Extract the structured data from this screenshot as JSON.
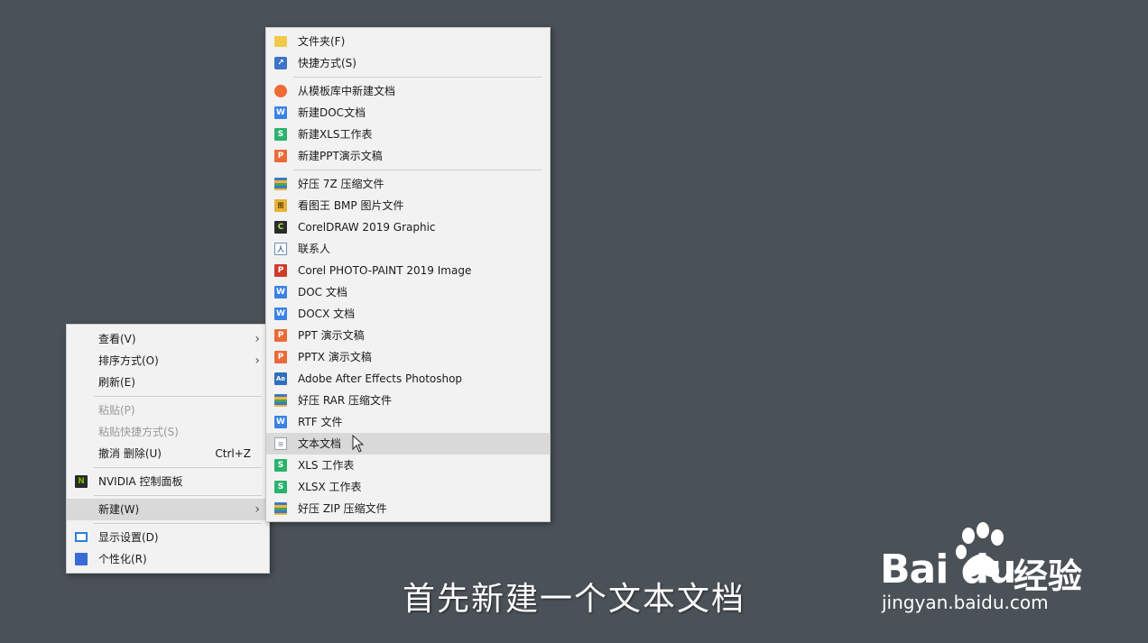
{
  "context_menu": {
    "items": [
      {
        "label": "查看(V)",
        "submenu": true
      },
      {
        "label": "排序方式(O)",
        "submenu": true
      },
      {
        "label": "刷新(E)"
      },
      {
        "label": "粘贴(P)",
        "disabled": true
      },
      {
        "label": "粘贴快捷方式(S)",
        "disabled": true
      },
      {
        "label": "撤消 删除(U)",
        "shortcut": "Ctrl+Z"
      },
      {
        "label": "NVIDIA 控制面板",
        "icon": "nvidia-icon"
      },
      {
        "label": "新建(W)",
        "submenu": true,
        "highlighted": true
      },
      {
        "label": "显示设置(D)",
        "icon": "display-icon"
      },
      {
        "label": "个性化(R)",
        "icon": "personalize-icon"
      }
    ]
  },
  "new_submenu": {
    "items": [
      {
        "label": "文件夹(F)",
        "icon": "folder-icon"
      },
      {
        "label": "快捷方式(S)",
        "icon": "shortcut-icon"
      },
      {
        "label": "从模板库中新建文档",
        "icon": "template-icon"
      },
      {
        "label": "新建DOC文档",
        "icon": "wps-writer-icon"
      },
      {
        "label": "新建XLS工作表",
        "icon": "wps-sheet-icon"
      },
      {
        "label": "新建PPT演示文稿",
        "icon": "wps-presentation-icon"
      },
      {
        "label": "好压 7Z 压缩文件",
        "icon": "archive-icon"
      },
      {
        "label": "看图王 BMP 图片文件",
        "icon": "bmp-image-icon"
      },
      {
        "label": "CorelDRAW 2019 Graphic",
        "icon": "coreldraw-icon"
      },
      {
        "label": "联系人",
        "icon": "contact-icon"
      },
      {
        "label": "Corel PHOTO-PAINT 2019 Image",
        "icon": "photo-paint-icon"
      },
      {
        "label": "DOC 文档",
        "icon": "wps-writer-icon"
      },
      {
        "label": "DOCX 文档",
        "icon": "wps-writer-icon"
      },
      {
        "label": "PPT 演示文稿",
        "icon": "wps-presentation-icon"
      },
      {
        "label": "PPTX 演示文稿",
        "icon": "wps-presentation-icon"
      },
      {
        "label": "Adobe After Effects Photoshop",
        "icon": "after-effects-icon"
      },
      {
        "label": "好压 RAR 压缩文件",
        "icon": "archive-icon"
      },
      {
        "label": "RTF 文件",
        "icon": "wps-writer-icon"
      },
      {
        "label": "文本文档",
        "icon": "text-document-icon",
        "highlighted": true
      },
      {
        "label": "XLS 工作表",
        "icon": "wps-sheet-icon"
      },
      {
        "label": "XLSX 工作表",
        "icon": "wps-sheet-icon"
      },
      {
        "label": "好压 ZIP 压缩文件",
        "icon": "archive-icon"
      }
    ]
  },
  "caption": "首先新建一个文本文档",
  "watermark": {
    "brand": "Bai du",
    "product": "经验",
    "url": "jingyan.baidu.com"
  },
  "icon_glyphs": {
    "w": "W",
    "s": "S",
    "p": "P",
    "bmp": "图",
    "cdr": "C",
    "contact": "人",
    "photo": "P",
    "ae": "Ae",
    "txt": "≡",
    "nvidia": "N"
  },
  "colors": {
    "desktop": "#4a5157",
    "menu_bg": "#f2f2f2",
    "highlight": "#d9d9d9",
    "disabled_text": "#9a9a9a"
  }
}
